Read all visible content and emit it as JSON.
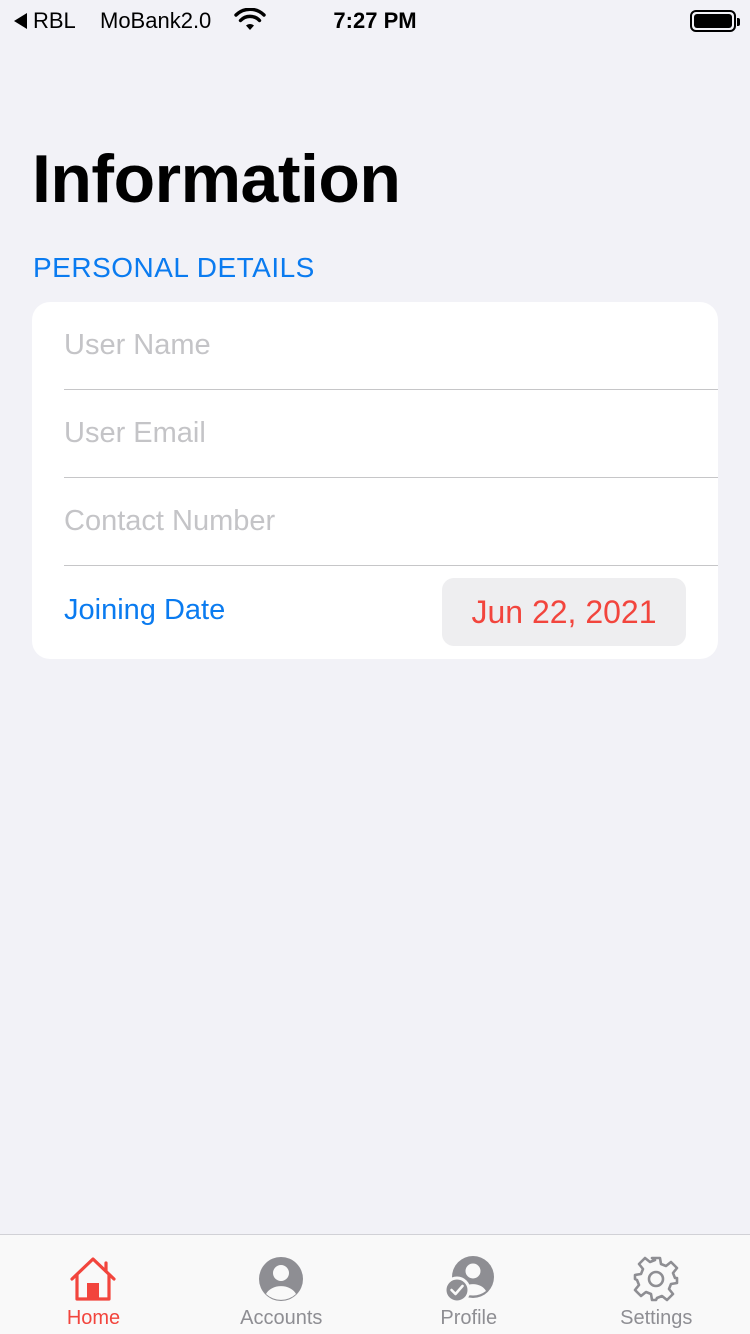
{
  "status_bar": {
    "back_app": "RBL",
    "carrier": "MoBank2.0",
    "time": "7:27 PM"
  },
  "page": {
    "title": "Information",
    "section_header": "PERSONAL DETAILS"
  },
  "form": {
    "user_name_placeholder": "User Name",
    "user_email_placeholder": "User Email",
    "contact_number_placeholder": "Contact Number",
    "joining_date_label": "Joining Date",
    "joining_date_value": "Jun 22, 2021"
  },
  "tabs": [
    {
      "label": "Home",
      "icon": "home-icon",
      "active": true
    },
    {
      "label": "Accounts",
      "icon": "person-circle-icon",
      "active": false
    },
    {
      "label": "Profile",
      "icon": "person-check-icon",
      "active": false
    },
    {
      "label": "Settings",
      "icon": "gear-icon",
      "active": false
    }
  ],
  "colors": {
    "accent_blue": "#0a7bf0",
    "accent_red": "#f2453d",
    "background": "#f2f2f7",
    "tab_inactive": "#8e8e93"
  }
}
